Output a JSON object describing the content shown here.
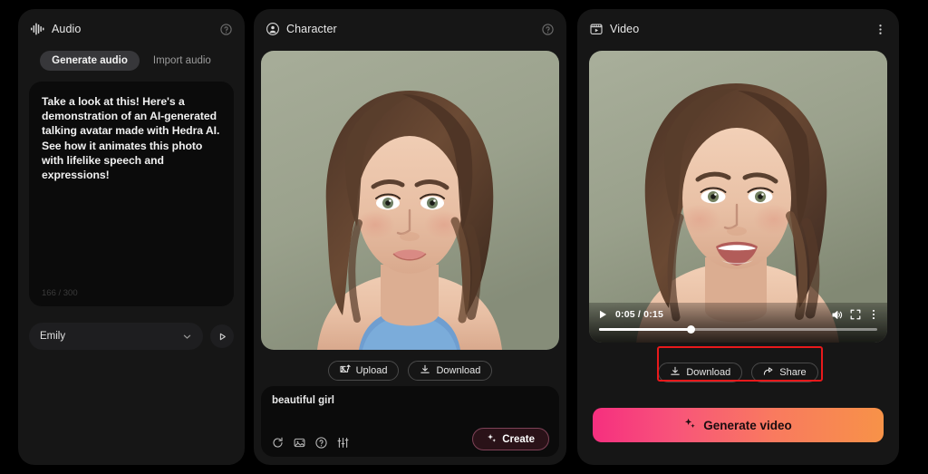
{
  "theme": {
    "page_bg": "#000000",
    "panel_bg": "#161616",
    "field_bg": "#0b0b0b",
    "accent_gradient_start": "#f62f7f",
    "accent_gradient_end": "#f79248",
    "highlight_outline": "#e8191b",
    "portrait_bg": "#9aa18c"
  },
  "audio_panel": {
    "icon": "waveform-icon",
    "title": "Audio",
    "help_icon": "help-circle-icon",
    "tabs": [
      {
        "label": "Generate audio",
        "active": true
      },
      {
        "label": "Import audio",
        "active": false
      }
    ],
    "script": "Take a look at this! Here's a demonstration of an AI-generated talking avatar made with Hedra AI. See how it animates this photo with lifelike speech and expressions!",
    "char_count": "166 / 300",
    "voice": {
      "value": "Emily",
      "chevron_icon": "chevron-down-icon",
      "play_icon": "play-triangle-icon"
    }
  },
  "character_panel": {
    "icon": "person-circle-icon",
    "title": "Character",
    "help_icon": "help-circle-icon",
    "portrait_alt": "ai-generated-female-portrait",
    "buttons": [
      {
        "label": "Upload",
        "icon": "upload-image-icon"
      },
      {
        "label": "Download",
        "icon": "download-icon"
      }
    ],
    "prompt": "beautiful girl",
    "tool_icons": [
      "refresh-icon",
      "image-variation-icon",
      "help-circle-icon",
      "sliders-icon"
    ],
    "create_button": {
      "label": "Create",
      "icon": "sparkle-icon"
    }
  },
  "video_panel": {
    "icon": "video-frame-icon",
    "title": "Video",
    "menu_icon": "kebab-menu-icon",
    "video_alt": "ai-generated-talking-avatar-frame",
    "player": {
      "play_icon": "play-icon",
      "current_time": "0:05",
      "duration": "0:15",
      "time_label": "0:05 / 0:15",
      "progress_percent": 33,
      "volume_icon": "volume-icon",
      "fullscreen_icon": "fullscreen-icon",
      "more_icon": "kebab-menu-icon"
    },
    "actions": [
      {
        "label": "Download",
        "icon": "download-icon"
      },
      {
        "label": "Share",
        "icon": "share-arrow-icon"
      }
    ],
    "generate_button": {
      "label": "Generate video",
      "icon": "sparkle-icon"
    }
  }
}
